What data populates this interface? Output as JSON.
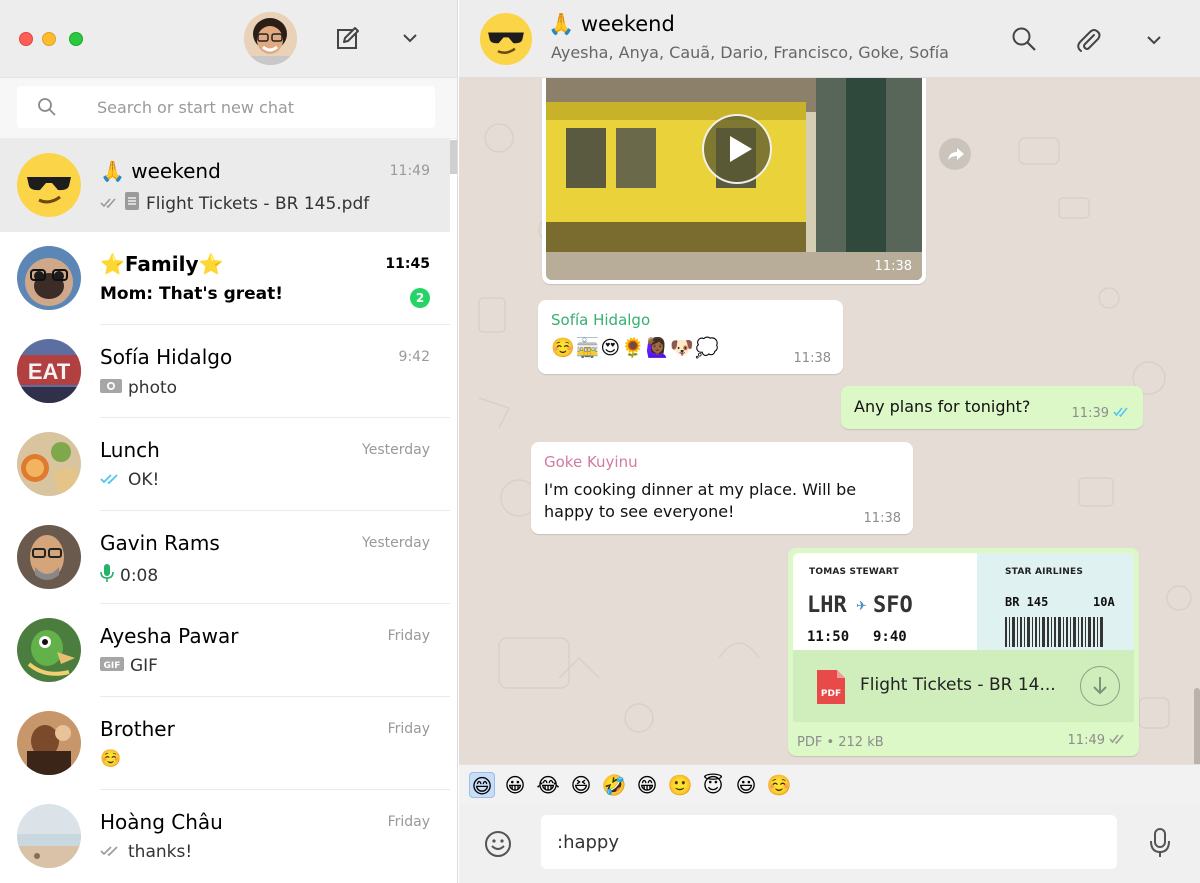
{
  "sidebar": {
    "search_placeholder": "Search or start new chat",
    "chats": [
      {
        "name": "🙏 weekend",
        "time": "11:49",
        "preview": "Flight Tickets - BR 145.pdf",
        "preview_icon": "document-icon",
        "status": "delivered-gray"
      },
      {
        "name": "⭐Family⭐",
        "time": "11:45",
        "preview": "Mom: That's great!",
        "unread": "2"
      },
      {
        "name": "Sofía Hidalgo",
        "time": "9:42",
        "preview": "photo",
        "preview_icon": "camera-icon"
      },
      {
        "name": "Lunch",
        "time": "Yesterday",
        "preview": "OK!",
        "status": "read-blue"
      },
      {
        "name": "Gavin Rams",
        "time": "Yesterday",
        "preview": "0:08",
        "preview_icon": "mic-icon"
      },
      {
        "name": "Ayesha Pawar",
        "time": "Friday",
        "preview": "GIF",
        "preview_icon": "gif-icon"
      },
      {
        "name": "Brother",
        "time": "Friday",
        "preview": "☺️"
      },
      {
        "name": "Hoàng Châu",
        "time": "Friday",
        "preview": "thanks!",
        "status": "delivered-gray"
      }
    ]
  },
  "conversation": {
    "title": "🙏 weekend",
    "members": "Ayesha, Anya, Cauã, Dario, Francisco, Goke, Sofía",
    "video_time": "11:38",
    "messages": [
      {
        "sender": "Sofía Hidalgo",
        "sender_color": "#35b06f",
        "text": "☺️🚋😍🌻🙋🏾‍♀️🐶💭",
        "time": "11:38"
      },
      {
        "text": "Any plans for tonight?",
        "time": "11:39"
      },
      {
        "sender": "Goke Kuyinu",
        "sender_color": "#d27aa1",
        "text_line1": "I'm cooking dinner at my place. Will be",
        "text_line2": "happy to see everyone!",
        "time": "11:38"
      }
    ],
    "document": {
      "passenger": "TOMAS STEWART",
      "airline": "STAR AIRLINES",
      "route_from": "LHR",
      "route_to": "SFO",
      "dep_time": "11:50",
      "arr_time": "9:40",
      "flight": "BR 145",
      "seat": "10A",
      "filename": "Flight Tickets - BR 14...",
      "meta": "PDF • 212 kB",
      "time": "11:49"
    },
    "suggestions": [
      "😄",
      "😀",
      "😂",
      "😆",
      "🤣",
      "😁",
      "🙂",
      "😇",
      "😃",
      "☺️"
    ],
    "composer_value": ":happy"
  },
  "colors": {
    "green_bubble": "#dcf8c6",
    "read_tick": "#4fc3f7",
    "unread_badge": "#25d366"
  }
}
